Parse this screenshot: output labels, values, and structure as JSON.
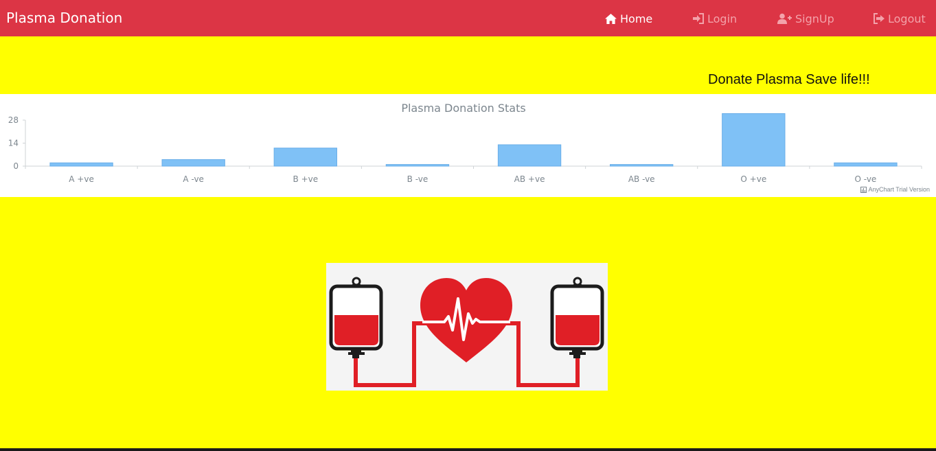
{
  "navbar": {
    "brand": "Plasma Donation",
    "items": [
      {
        "label": "Home",
        "icon": "home-icon",
        "active": true
      },
      {
        "label": "Login",
        "icon": "sign-in-icon",
        "active": false
      },
      {
        "label": "SignUp",
        "icon": "user-plus-icon",
        "active": false
      },
      {
        "label": "Logout",
        "icon": "sign-out-icon",
        "active": false
      }
    ]
  },
  "banner": {
    "tagline": "Donate Plasma Save life!!!"
  },
  "chart_data": {
    "type": "bar",
    "title": "Plasma Donation Stats",
    "categories": [
      "A +ve",
      "A -ve",
      "B +ve",
      "B -ve",
      "AB +ve",
      "AB -ve",
      "O +ve",
      "O -ve"
    ],
    "values": [
      2,
      4,
      11,
      1,
      13,
      1,
      32,
      2
    ],
    "yticks": [
      0,
      14,
      28
    ],
    "ylim": [
      0,
      28
    ],
    "bar_color": "#7fc1f6",
    "credits": "AnyChart Trial Version"
  },
  "colors": {
    "navbar": "#dc3545",
    "page_background": "#ffff00",
    "blood_red": "#e01f26"
  }
}
